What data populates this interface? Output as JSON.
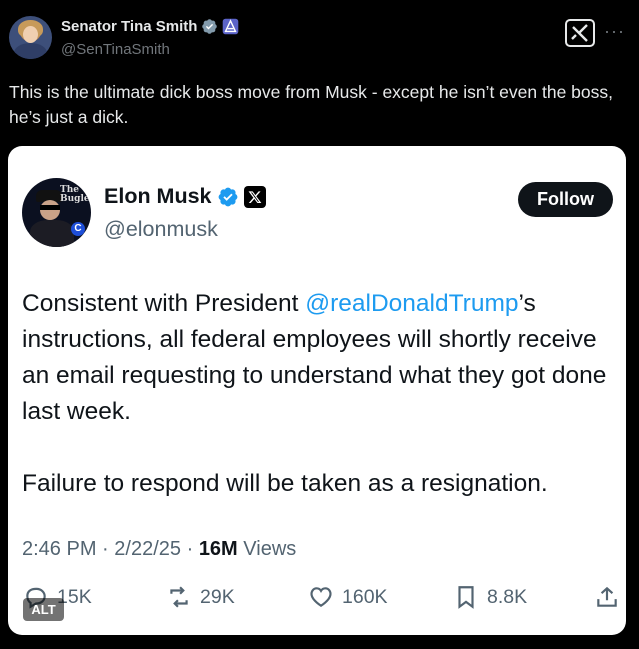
{
  "author": {
    "display_name": "Senator Tina Smith",
    "handle": "@SenTinaSmith",
    "icons": [
      "verified-gray-icon",
      "government-badge-icon"
    ]
  },
  "header_actions": {
    "grok_icon": "grok-icon",
    "more_label": "···"
  },
  "tweet": {
    "text": "This is the ultimate dick boss move from Musk - except he isn’t even the boss, he’s just a dick."
  },
  "embedded": {
    "avatar_text": "The Bugle",
    "name": "Elon Musk",
    "handle": "@elonmusk",
    "follow_label": "Follow",
    "body_before": "Consistent with President ",
    "mention": "@realDonaldTrump",
    "body_after": "’s instructions, all federal employees will shortly receive an email requesting to understand what they got done last week.",
    "body_paragraph2": "Failure to respond will be taken as a resignation.",
    "time": "2:46 PM",
    "date": "2/22/25",
    "views_count": "16M",
    "views_label": "Views",
    "separator": "·",
    "actions": {
      "replies": "15K",
      "reposts": "29K",
      "likes": "160K",
      "bookmarks": "8.8K"
    },
    "alt_label": "ALT"
  },
  "colors": {
    "background": "#000000",
    "card": "#ffffff",
    "mention": "#1d9bf0",
    "verified": "#1d9bf0",
    "muted": "#536471"
  }
}
